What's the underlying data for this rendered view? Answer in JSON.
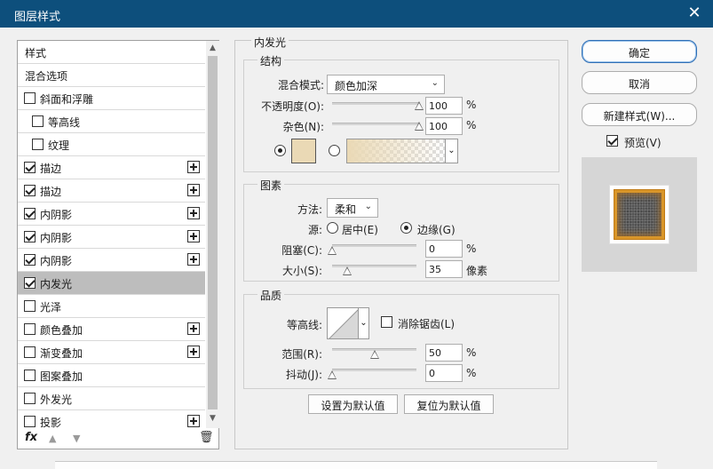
{
  "window": {
    "title": "图层样式",
    "close_glyph": "✕"
  },
  "style_list": {
    "items": [
      {
        "label": "样式",
        "checkbox": false,
        "checked": false,
        "plus": false,
        "indent": 0,
        "selected": false
      },
      {
        "label": "混合选项",
        "checkbox": false,
        "checked": false,
        "plus": false,
        "indent": 0,
        "selected": false
      },
      {
        "label": "斜面和浮雕",
        "checkbox": true,
        "checked": false,
        "plus": false,
        "indent": 0,
        "selected": false
      },
      {
        "label": "等高线",
        "checkbox": true,
        "checked": false,
        "plus": false,
        "indent": 1,
        "selected": false
      },
      {
        "label": "纹理",
        "checkbox": true,
        "checked": false,
        "plus": false,
        "indent": 1,
        "selected": false
      },
      {
        "label": "描边",
        "checkbox": true,
        "checked": true,
        "plus": true,
        "indent": 0,
        "selected": false
      },
      {
        "label": "描边",
        "checkbox": true,
        "checked": true,
        "plus": true,
        "indent": 0,
        "selected": false
      },
      {
        "label": "内阴影",
        "checkbox": true,
        "checked": true,
        "plus": true,
        "indent": 0,
        "selected": false
      },
      {
        "label": "内阴影",
        "checkbox": true,
        "checked": true,
        "plus": true,
        "indent": 0,
        "selected": false
      },
      {
        "label": "内阴影",
        "checkbox": true,
        "checked": true,
        "plus": true,
        "indent": 0,
        "selected": false
      },
      {
        "label": "内发光",
        "checkbox": true,
        "checked": true,
        "plus": false,
        "indent": 0,
        "selected": true
      },
      {
        "label": "光泽",
        "checkbox": true,
        "checked": false,
        "plus": false,
        "indent": 0,
        "selected": false
      },
      {
        "label": "颜色叠加",
        "checkbox": true,
        "checked": false,
        "plus": true,
        "indent": 0,
        "selected": false
      },
      {
        "label": "渐变叠加",
        "checkbox": true,
        "checked": false,
        "plus": true,
        "indent": 0,
        "selected": false
      },
      {
        "label": "图案叠加",
        "checkbox": true,
        "checked": false,
        "plus": false,
        "indent": 0,
        "selected": false
      },
      {
        "label": "外发光",
        "checkbox": true,
        "checked": false,
        "plus": false,
        "indent": 0,
        "selected": false
      },
      {
        "label": "投影",
        "checkbox": true,
        "checked": false,
        "plus": true,
        "indent": 0,
        "selected": false
      }
    ],
    "footer": {
      "fx": "fx",
      "move_up": "▲",
      "move_down": "▼",
      "delete": "🗑"
    }
  },
  "panel": {
    "title": "内发光",
    "structure": {
      "title": "结构",
      "blend_mode_label": "混合模式:",
      "blend_mode_value": "颜色加深",
      "opacity_label": "不透明度(O):",
      "opacity_value": "100",
      "opacity_pct": 100,
      "noise_label": "杂色(N):",
      "noise_value": "100",
      "noise_pct": 100,
      "unit_pct": "%",
      "color_mode": "solid",
      "glow_color": "#ead9b5"
    },
    "elements": {
      "title": "图素",
      "technique_label": "方法:",
      "technique_value": "柔和",
      "source_label": "源:",
      "source_center_label": "居中(E)",
      "source_edge_label": "边缘(G)",
      "source_selected": "edge",
      "choke_label": "阻塞(C):",
      "choke_value": "0",
      "choke_pct": 0,
      "size_label": "大小(S):",
      "size_value": "35",
      "size_unit": "像素",
      "unit_pct": "%"
    },
    "quality": {
      "title": "品质",
      "contour_label": "等高线:",
      "antialias_label": "消除锯齿(L)",
      "antialias_checked": false,
      "range_label": "范围(R):",
      "range_value": "50",
      "range_pct": 50,
      "jitter_label": "抖动(J):",
      "jitter_value": "0",
      "jitter_pct": 0,
      "unit_pct": "%"
    },
    "buttons": {
      "make_default": "设置为默认值",
      "reset_default": "复位为默认值"
    }
  },
  "actions": {
    "ok": "确定",
    "cancel": "取消",
    "new_style": "新建样式(W)...",
    "preview_label": "预览(V)",
    "preview_checked": true
  },
  "colors": {
    "titlebar": "#0d4f7c",
    "glow": "#ead9b5",
    "thumbnail_edge": "#d9962a"
  }
}
